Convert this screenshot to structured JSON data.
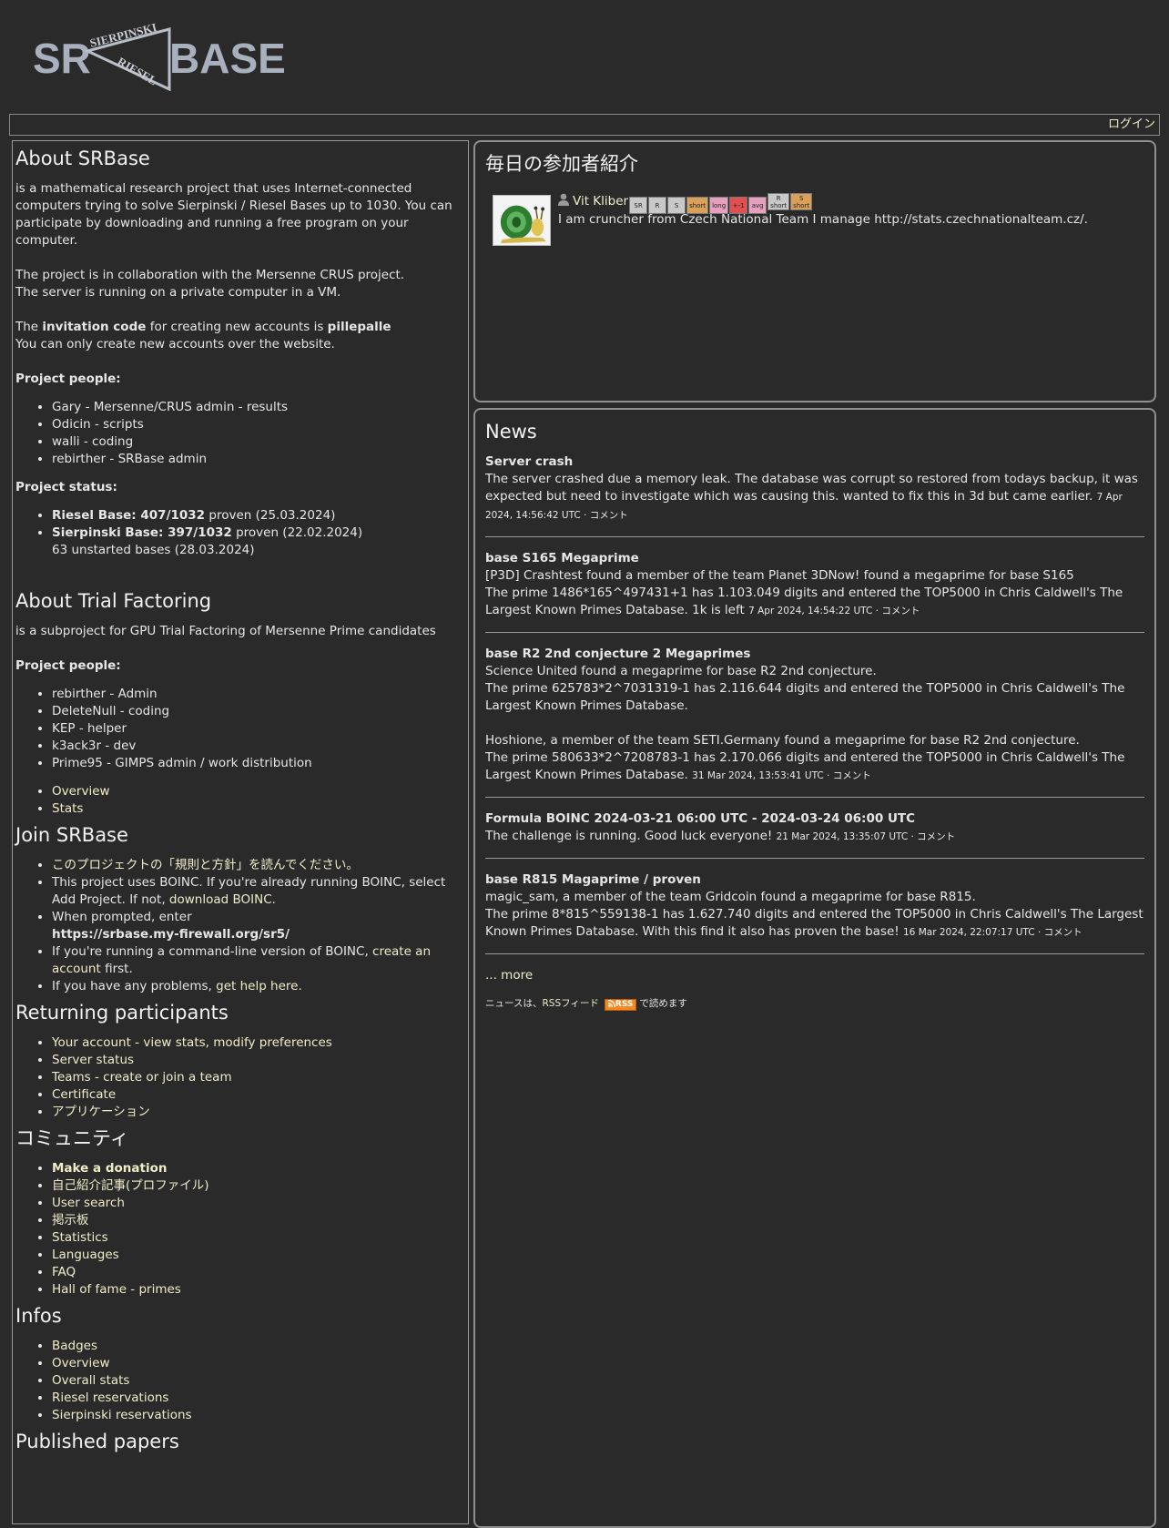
{
  "logo": {
    "left": "SR",
    "right": "BASE",
    "top_word": "SIERPINSKI",
    "bottom_word": "RIESEL"
  },
  "nav": {
    "login": "ログイン"
  },
  "about": {
    "title": "About SRBase",
    "intro": "is a mathematical research project that uses Internet-connected computers trying to solve Sierpinski / Riesel Bases up to 1030. You can participate by downloading and running a free program on your computer.",
    "collab_line1": "The project is in collaboration with the Mersenne CRUS project.",
    "collab_line2": "The server is running on a private computer in a VM.",
    "invite_prefix": "The ",
    "invite_bold": "invitation code",
    "invite_mid": " for creating new accounts is ",
    "invite_code": "pillepalle",
    "invite_line2": "You can only create new accounts over the website.",
    "people_heading": "Project people:",
    "people": [
      "Gary - Mersenne/CRUS admin - results",
      "Odicin - scripts",
      "walli - coding",
      "rebirther - SRBase admin"
    ],
    "status_heading": "Project status:",
    "riesel_bold": "Riesel Base: 407/1032",
    "riesel_rest": " proven (25.03.2024)",
    "sierp_bold": "Sierpinski Base: 397/1032",
    "sierp_rest": " proven (22.02.2024)",
    "unstarted": "63 unstarted bases (28.03.2024)"
  },
  "trial": {
    "title": "About Trial Factoring",
    "intro": "is a subproject for GPU Trial Factoring of Mersenne Prime candidates",
    "people_heading": "Project people:",
    "people": [
      "rebirther - Admin",
      "DeleteNull - coding",
      "KEP - helper",
      "k3ack3r - dev",
      "Prime95 - GIMPS admin / work distribution"
    ],
    "links": [
      "Overview",
      "Stats"
    ]
  },
  "join": {
    "title": "Join SRBase",
    "rules": "このプロジェクトの「規則と方針」を読んでください。",
    "boinc_pre": "This project uses BOINC. If you're already running BOINC, select Add Project. If not, ",
    "boinc_link": "download BOINC.",
    "prompt_pre": "When prompted, enter",
    "prompt_url": "https://srbase.my-firewall.org/sr5/",
    "cmd_pre": "If you're running a command-line version of BOINC, ",
    "cmd_link": "create an account",
    "cmd_post": " first.",
    "help_pre": "If you have any problems, ",
    "help_link": "get help here."
  },
  "returning": {
    "title": "Returning participants",
    "links": [
      "Your account - view stats, modify preferences",
      "Server status",
      "Teams - create or join a team",
      "Certificate",
      "アプリケーション"
    ]
  },
  "community": {
    "title": "コミュニティ",
    "donation": "Make a donation",
    "links": [
      "自己紹介記事(プロファイル)",
      "User search",
      "掲示板",
      "Statistics",
      "Languages",
      "FAQ",
      "Hall of fame - primes"
    ]
  },
  "infos": {
    "title": "Infos",
    "links": [
      "Badges",
      "Overview",
      "Overall stats",
      "Riesel reservations",
      "Sierpinski reservations"
    ]
  },
  "papers": {
    "title": "Published papers"
  },
  "profile": {
    "title": "毎日の参加者紹介",
    "user_name": "Vit Kliber",
    "badges": [
      {
        "l1": "SR",
        "l2": "",
        "color": "#c8c8c8"
      },
      {
        "l1": "R",
        "l2": "",
        "color": "#c8c8c8"
      },
      {
        "l1": "S",
        "l2": "",
        "color": "#c8c8c8"
      },
      {
        "l1": "short",
        "l2": "",
        "color": "#d9a05a"
      },
      {
        "l1": "long",
        "l2": "",
        "color": "#e8a0c0"
      },
      {
        "l1": "+-1",
        "l2": "",
        "color": "#e05050"
      },
      {
        "l1": "avg",
        "l2": "",
        "color": "#e8a0c0"
      },
      {
        "l1": "R",
        "l2": "short",
        "color": "#c8c8c8"
      },
      {
        "l1": "S",
        "l2": "short",
        "color": "#d9a05a"
      }
    ],
    "text": "I am cruncher from Czech National Team I manage http://stats.czechnationalteam.cz/."
  },
  "news": {
    "title": "News",
    "comment_label": "コメント",
    "items": [
      {
        "title": "Server crash",
        "paras": [
          "The server crashed due a memory leak. The database was corrupt so restored from todays backup, it was expected but need to investigate which was causing this. wanted to fix this in 3d but came earlier."
        ],
        "date": "7 Apr 2024, 14:56:42 UTC"
      },
      {
        "title": "base S165 Megaprime",
        "paras": [
          "[P3D] Crashtest found a member of the team Planet 3DNow! found a megaprime for base S165\nThe prime 1486*165^497431+1 has 1.103.049 digits and entered the TOP5000 in Chris Caldwell's The Largest Known Primes Database. 1k is left"
        ],
        "date": "7 Apr 2024, 14:54:22 UTC"
      },
      {
        "title": "base R2 2nd conjecture 2 Megaprimes",
        "paras": [
          "Science United found a megaprime for base R2 2nd conjecture.\nThe prime 625783*2^7031319-1 has 2.116.644 digits and entered the TOP5000 in Chris Caldwell's The Largest Known Primes Database.",
          "Hoshione, a member of the team SETI.Germany found a megaprime for base R2 2nd conjecture.\nThe prime 580633*2^7208783-1 has 2.170.066 digits and entered the TOP5000 in Chris Caldwell's The Largest Known Primes Database."
        ],
        "date": "31 Mar 2024, 13:53:41 UTC"
      },
      {
        "title": "Formula BOINC 2024-03-21 06:00 UTC - 2024-03-24 06:00 UTC",
        "paras": [
          "The challenge is running. Good luck everyone!"
        ],
        "date": "21 Mar 2024, 13:35:07 UTC"
      },
      {
        "title": "base R815 Magaprime / proven",
        "paras": [
          "magic_sam, a member of the team Gridcoin found a megaprime for base R815.\nThe prime 8*815^559138-1 has 1.627.740 digits and entered the TOP5000 in Chris Caldwell's The Largest Known Primes Database. With this find it also has proven the base!"
        ],
        "date": "16 Mar 2024, 22:07:17 UTC"
      }
    ],
    "more": "... more",
    "rss_pre": "ニュースは、",
    "rss_link": "RSSフィード",
    "rss_badge": "RSS",
    "rss_post": "で読めます"
  }
}
